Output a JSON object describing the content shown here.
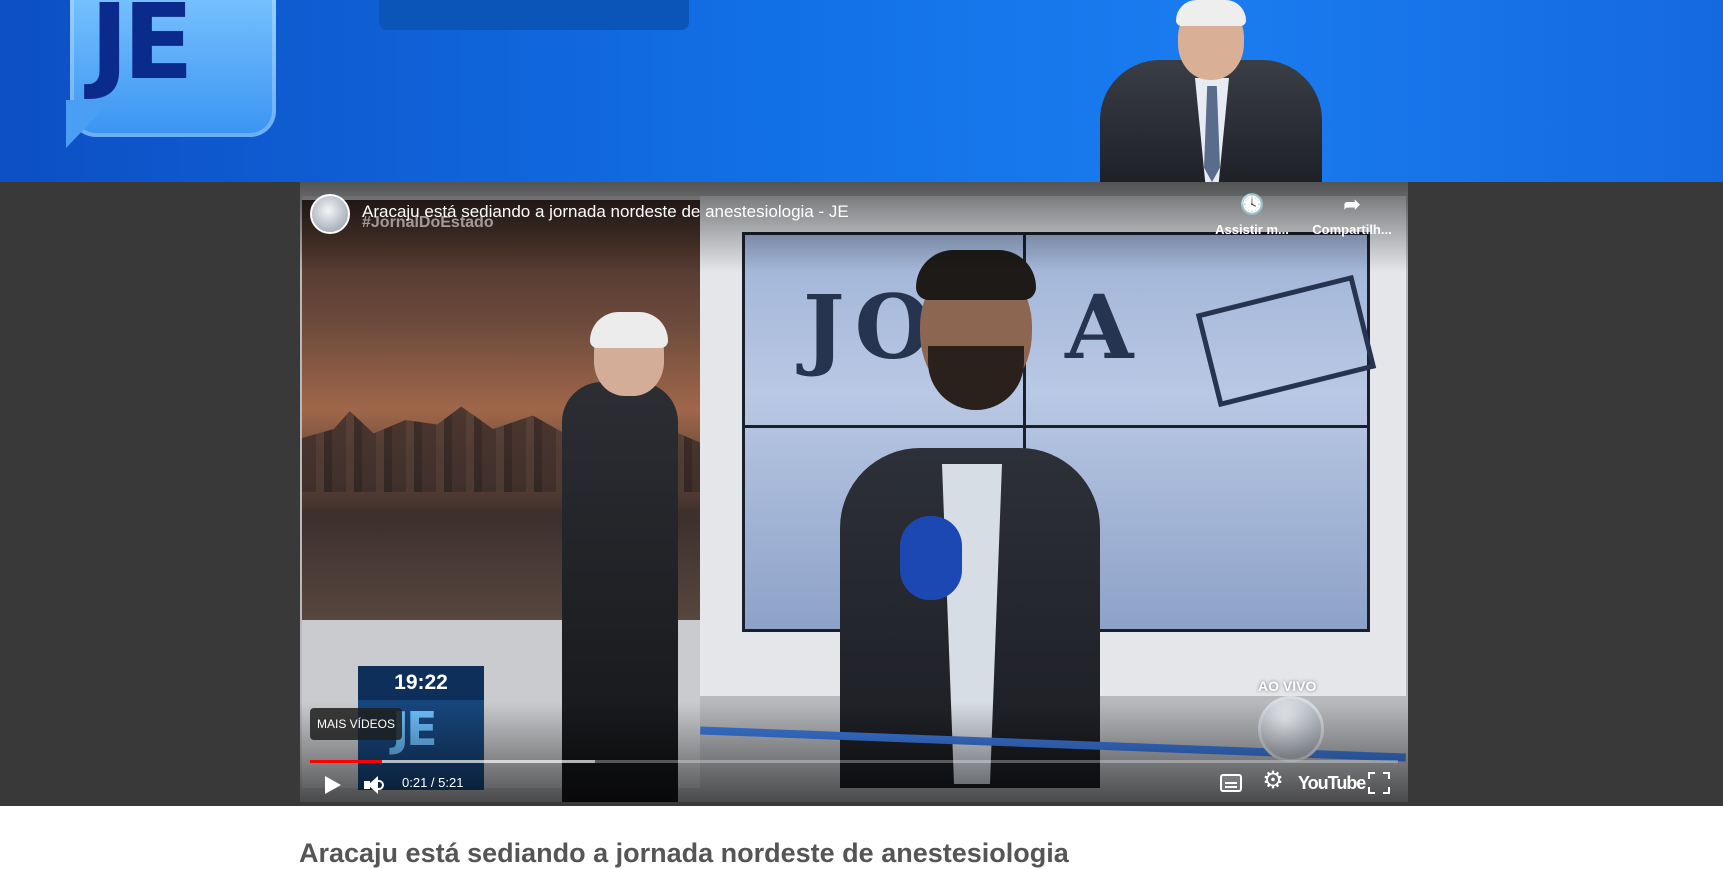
{
  "header": {
    "logo_text": "JE",
    "colors": {
      "banner": "#1270e6",
      "logo_letters": "#0a2a8c"
    }
  },
  "player": {
    "video_title": "Aracaju está sediando a jornada nordeste de anestesiologia - JE",
    "hashtag": "#JornalDoEstado",
    "watch_later_label": "Assistir m...",
    "watch_later_icon": "clock-icon",
    "share_label": "Compartilh...",
    "share_icon": "share-arrow-icon",
    "more_videos_label": "MAIS VÍDEOS",
    "overlay_time": "19:22",
    "overlay_logo": "JE",
    "live_label": "AO VIVO",
    "time_display": "0:21 / 5:21",
    "progress": {
      "played_fraction": 0.066,
      "buffered_fraction": 0.262
    },
    "youtube_label": "YouTube",
    "colors": {
      "progress_played": "#ff0000"
    }
  },
  "article": {
    "title": "Aracaju está sediando a jornada nordeste de anestesiologia"
  }
}
